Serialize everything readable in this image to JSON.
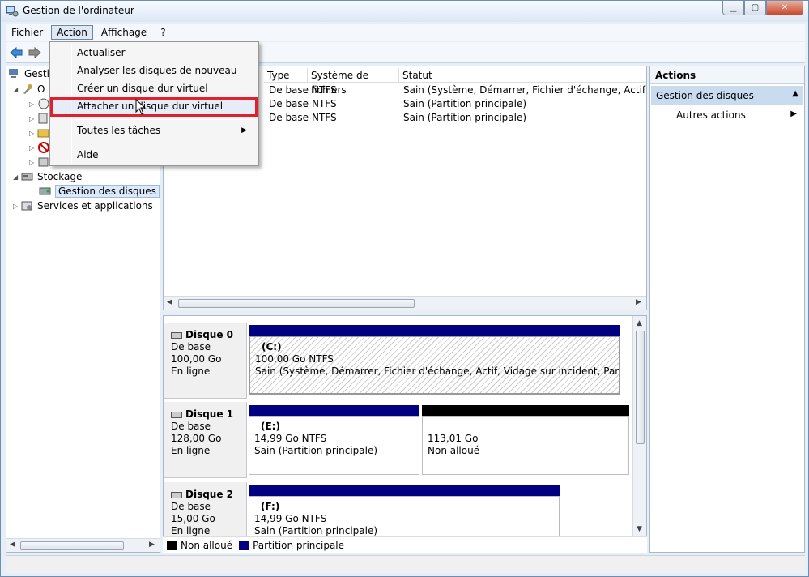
{
  "window": {
    "title": "Gestion de l'ordinateur",
    "buttons": [
      "minimize",
      "maximize",
      "close"
    ]
  },
  "menubar": {
    "items": [
      "Fichier",
      "Action",
      "Affichage",
      "?"
    ],
    "active": "Action"
  },
  "tree": {
    "root_label": "Gesti",
    "system_label": "O",
    "storage_label": "Stockage",
    "disk_mgmt_label": "Gestion des disques",
    "services_label": "Services et applications"
  },
  "list": {
    "columns": [
      "Type",
      "Système de fichiers",
      "Statut"
    ],
    "rows": [
      {
        "type": "De base",
        "fs": "NTFS",
        "status": "Sain (Système, Démarrer, Fichier d'échange, Actif, Vidage"
      },
      {
        "type": "De base",
        "fs": "NTFS",
        "status": "Sain (Partition principale)"
      },
      {
        "type": "De base",
        "fs": "NTFS",
        "status": "Sain (Partition principale)"
      }
    ]
  },
  "disks": [
    {
      "name": "Disque 0",
      "kind": "De base",
      "size": "100,00 Go",
      "state": "En ligne",
      "partitions": [
        {
          "label": "(C:)",
          "size": "100,00 Go NTFS",
          "status": "Sain (Système, Démarrer, Fichier d'échange, Actif, Vidage sur incident, Partition princ"
        }
      ]
    },
    {
      "name": "Disque 1",
      "kind": "De base",
      "size": "128,00 Go",
      "state": "En ligne",
      "partitions": [
        {
          "label": "(E:)",
          "size": "14,99 Go NTFS",
          "status": "Sain (Partition principale)"
        },
        {
          "label": "",
          "size": "113,01 Go",
          "status": "Non alloué"
        }
      ]
    },
    {
      "name": "Disque 2",
      "kind": "De base",
      "size": "15,00 Go",
      "state": "En ligne",
      "partitions": [
        {
          "label": "(F:)",
          "size": "14,99 Go NTFS",
          "status": "Sain (Partition principale)"
        }
      ]
    }
  ],
  "legend": {
    "unallocated": "Non alloué",
    "primary": "Partition principale"
  },
  "actions": {
    "title": "Actions",
    "section": "Gestion des disques",
    "more": "Autres actions"
  },
  "dropdown": {
    "items": [
      "Actualiser",
      "Analyser les disques de nouveau",
      "Créer un disque dur virtuel",
      "Attacher un disque dur virtuel",
      "Toutes les tâches",
      "Aide"
    ],
    "highlighted_index": 3
  },
  "colors": {
    "primary_partition": "#000080",
    "unallocated": "#000000",
    "highlight_box": "#e0202a"
  }
}
